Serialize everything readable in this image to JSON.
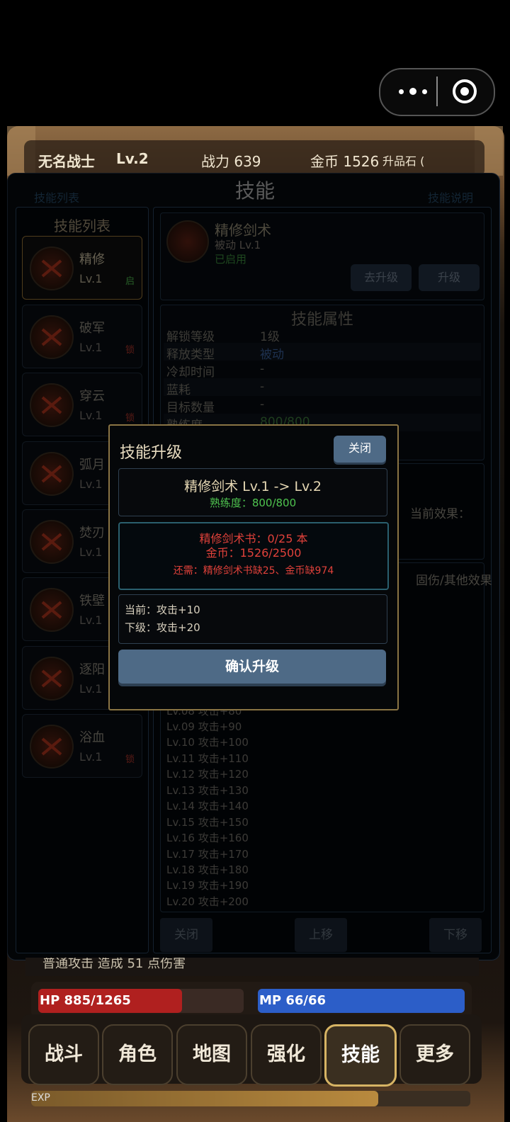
{
  "topbar": {
    "name": "无名战士",
    "level": "Lv.2",
    "power": "战力 639",
    "gold": "金币 1526",
    "stones": "升品石 (",
    "title_text": "技能",
    "ghost_left": "技能列表",
    "ghost_right": "技能说明"
  },
  "skill_list": {
    "header": "技能列表",
    "items": [
      {
        "name": "精修",
        "level": "Lv.1",
        "status": "启",
        "status_color": "#3c8f3c"
      },
      {
        "name": "破军",
        "level": "Lv.1",
        "status": "锁",
        "status_color": "#8a2a22"
      },
      {
        "name": "穿云",
        "level": "Lv.1",
        "status": "锁",
        "status_color": "#8a2a22"
      },
      {
        "name": "弧月",
        "level": "Lv.1",
        "status": "",
        "status_color": "#8a2a22"
      },
      {
        "name": "焚刃",
        "level": "Lv.1",
        "status": "",
        "status_color": "#8a2a22"
      },
      {
        "name": "铁壁",
        "level": "Lv.1",
        "status": "",
        "status_color": "#8a2a22"
      },
      {
        "name": "逐阳",
        "level": "Lv.1",
        "status": "",
        "status_color": "#8a2a22"
      },
      {
        "name": "浴血",
        "level": "Lv.1",
        "status": "锁",
        "status_color": "#8a2a22"
      }
    ]
  },
  "detail": {
    "name": "精修剑术",
    "type_level": "被动  Lv.1",
    "state": "已启用",
    "goto_upgrade": "去升级",
    "upgrade": "升级",
    "attr_title": "技能属性",
    "attrs": [
      {
        "k": "解锁等级",
        "v": "1级"
      },
      {
        "k": "释放类型",
        "v": "被动"
      },
      {
        "k": "冷却时间",
        "v": "-"
      },
      {
        "k": "蓝耗",
        "v": "-"
      },
      {
        "k": "目标数量",
        "v": "-"
      },
      {
        "k": "熟练度",
        "v": "800/800"
      }
    ],
    "effect_label": "当前效果：",
    "list_hint": "固伤/其他效果",
    "levels": [
      "Lv.08  攻击+80",
      "Lv.09  攻击+90",
      "Lv.10  攻击+100",
      "Lv.11  攻击+110",
      "Lv.12  攻击+120",
      "Lv.13  攻击+130",
      "Lv.14  攻击+140",
      "Lv.15  攻击+150",
      "Lv.16  攻击+160",
      "Lv.17  攻击+170",
      "Lv.18  攻击+180",
      "Lv.19  攻击+190",
      "Lv.20  攻击+200"
    ],
    "close": "关闭",
    "move_up": "上移",
    "move_down": "下移"
  },
  "modal": {
    "title": "技能升级",
    "close": "关闭",
    "skill_line": "精修剑术  Lv.1 -> Lv.2",
    "proficiency": "熟练度：800/800",
    "book_req": "精修剑术书：0/25 本",
    "gold_req": "金币：1526/2500",
    "missing": "还需：精修剑术书缺25、金币缺974",
    "current": "当前：攻击+10",
    "next": "下级：攻击+20",
    "confirm": "确认升级"
  },
  "log": {
    "text": "普通攻击 造成 51 点伤害"
  },
  "status": {
    "hp_text": "HP 885/1265",
    "hp_current": 885,
    "hp_max": 1265,
    "mp_text": "MP 66/66",
    "mp_current": 66,
    "mp_max": 66,
    "exp_label": "EXP",
    "exp_fraction": 0.79,
    "hp_color": "#b0201f",
    "mp_color": "#2c5ec8"
  },
  "nav": {
    "items": [
      "战斗",
      "角色",
      "地图",
      "强化",
      "技能",
      "更多"
    ],
    "active": "技能"
  }
}
